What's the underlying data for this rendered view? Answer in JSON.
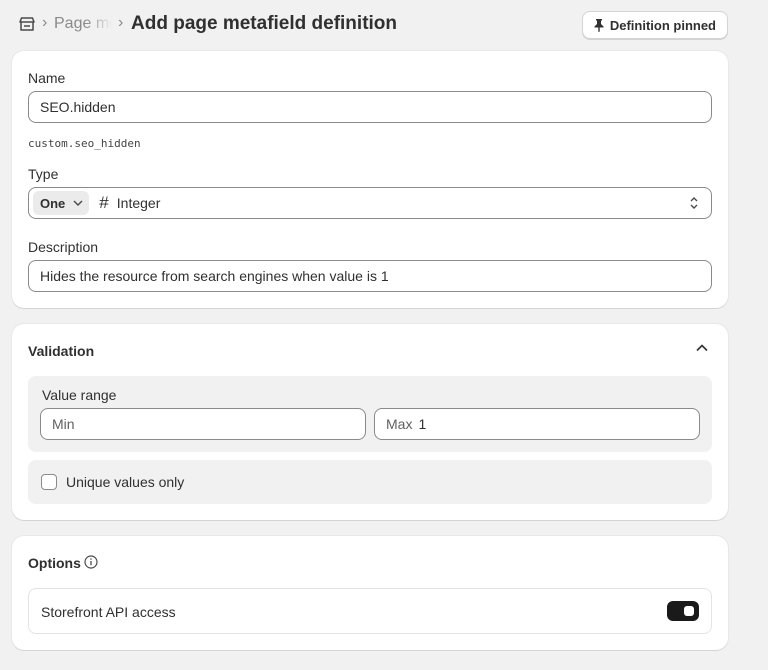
{
  "header": {
    "breadcrumb": "Page metafield definitions",
    "separator": "›",
    "title": "Add page metafield definition",
    "pin_button": "Definition pinned"
  },
  "definition": {
    "name_label": "Name",
    "name_value": "SEO.hidden",
    "namespace_key": "custom.seo_hidden",
    "type_label": "Type",
    "type_cardinality": "One",
    "type_icon": "#",
    "type_value": "Integer",
    "description_label": "Description",
    "description_value": "Hides the resource from search engines when value is 1"
  },
  "validation": {
    "title": "Validation",
    "range_label": "Value range",
    "min_prefix": "Min",
    "max_prefix": "Max",
    "max_value": "1",
    "unique_label": "Unique values only",
    "unique_checked": false
  },
  "options": {
    "title": "Options",
    "storefront_label": "Storefront API access",
    "storefront_enabled": true
  },
  "colors": {
    "background": "#f1f1f1",
    "card": "#ffffff",
    "toggle_on": "#1a1a1a",
    "text": "#303030",
    "muted": "#8a8a8a"
  }
}
